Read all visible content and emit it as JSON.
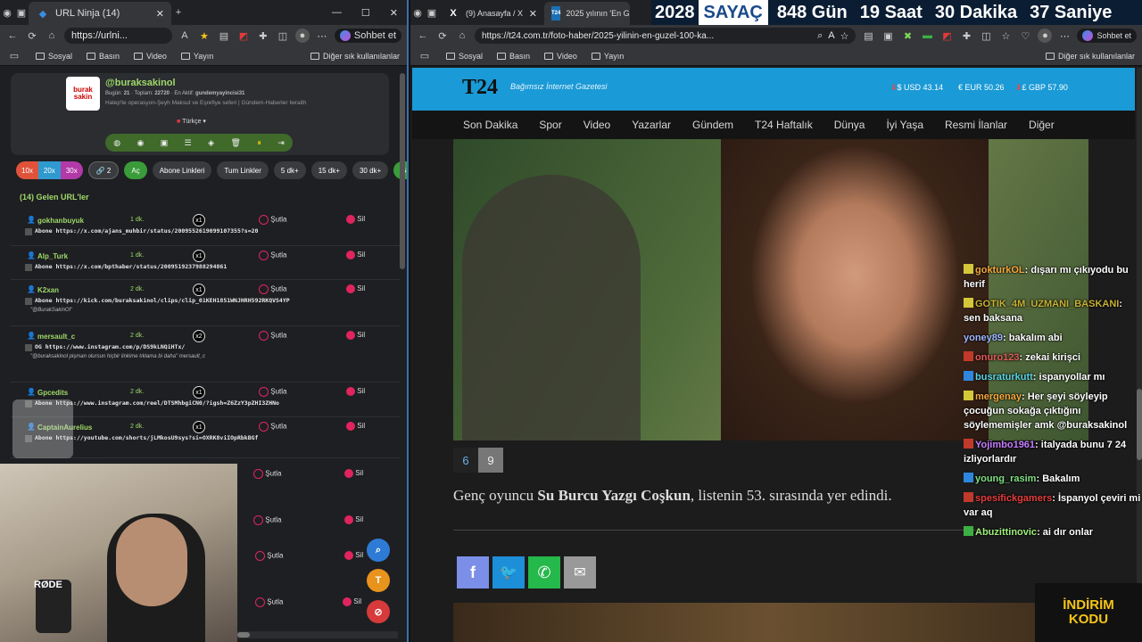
{
  "overlay": {
    "year": "2028",
    "label": "SAYAÇ",
    "days": "848 Gün",
    "hours": "19 Saat",
    "minutes": "30 Dakika",
    "seconds": "37 Saniye",
    "promo_line1": "İNDİRİM",
    "promo_line2": "KODU",
    "mic_brand": "RØDE"
  },
  "left": {
    "tab_title": "URL Ninja (14)",
    "url": "https://urlni...",
    "chat_btn": "Sohbet et",
    "bookmarks": [
      "Sosyal",
      "Basın",
      "Video",
      "Yayın"
    ],
    "other_bookmarks": "Diğer sık kullanılanlar",
    "profile": {
      "handle": "@buraksakinol",
      "today_label": "Bugün:",
      "today": "21",
      "total_label": "Toplam:",
      "total": "22720",
      "active_label": "En Aktif:",
      "active": "gundemyayincisi31",
      "desc": "Halep'te operasyon-Şeyh Maksut ve Eşrefiye seferi | Gündem-Haberler Iwraith",
      "lang": "Türkçe"
    },
    "pills": [
      "10x",
      "20x",
      "30x",
      "2",
      "Aç",
      "Abone Linkleri",
      "Tum Linkler",
      "5 dk+",
      "15 dk+",
      "30 dk+",
      "Güven"
    ],
    "heading": "(14) Gelen URL'ler",
    "action_label": "Şutla",
    "delete_label": "Sil",
    "rows": [
      {
        "user": "gokhanbuyuk",
        "time": "1 dk.",
        "count": "x1",
        "link": "Abone https://x.com/ajans_muhbir/status/2009552619099107355?s=20",
        "note": ""
      },
      {
        "user": "Alp_Turk",
        "time": "1 dk.",
        "count": "x1",
        "link": "Abone https://x.com/bpthaber/status/2009519237988294861",
        "note": ""
      },
      {
        "user": "K2xan",
        "time": "2 dk.",
        "count": "x1",
        "link": "Abone https://kick.com/buraksakinol/clips/clip_01KEH1851WNJHRH592RKQVS4YP",
        "note": "\"@BurakSakinOl\""
      },
      {
        "user": "mersault_c",
        "time": "2 dk.",
        "count": "x2",
        "link": "OG https://www.instagram.com/p/DS9kLNQiHTx/",
        "note": "\"@buraksakinol pişman olursun hiçbir linkime tıklama bi daha\" mersault_c"
      },
      {
        "user": "Gpcedits",
        "time": "2 dk.",
        "count": "x1",
        "link": "Abone https://www.instagram.com/reel/DTSMhbgiCN0/?igsh=Z6ZzY3pZHI3ZHNo",
        "note": ""
      },
      {
        "user": "CaptainAurelius",
        "time": "2 dk.",
        "count": "x1",
        "link": "Abone https://youtube.com/shorts/jLMkosU9sys?si=OXRK8viIOpRbkBGf",
        "note": ""
      }
    ],
    "lower_actions": [
      "Şutla",
      "Şutla",
      "Şutla",
      "Şutla"
    ],
    "lower_deletes": [
      "Sil",
      "Sil",
      "Sil",
      "Sil"
    ],
    "fab_t": "T"
  },
  "right": {
    "tabs": [
      "(9) Anasayfa / X",
      "2025 yılının 'En Güze"
    ],
    "url": "https://t24.com.tr/foto-haber/2025-yilinin-en-guzel-100-ka...",
    "chat_btn": "Sohbet et",
    "bookmarks": [
      "Sosyal",
      "Basın",
      "Video",
      "Yayın"
    ],
    "other_bookmarks": "Diğer sık kullanılanlar",
    "site": {
      "logo": "T24",
      "tagline": "Bağımsız İnternet Gazetesi",
      "usd": "$ USD 43.14",
      "eur": "€ EUR 50.26",
      "gbp": "£ GBP 57.90"
    },
    "nav": [
      "Son Dakika",
      "Spor",
      "Video",
      "Yazarlar",
      "Gündem",
      "T24 Haftalık",
      "Dünya",
      "İyi Yaşa",
      "Resmi İlanlar",
      "Diğer"
    ],
    "pager": [
      "6",
      "9"
    ],
    "caption_pre": "Genç oyuncu ",
    "caption_bold": "Su Burcu Yazgı Coşkun",
    "caption_post": ", listenin 53. sırasında yer edindi."
  },
  "chat": [
    {
      "user": "gokturkOL",
      "text": "dışarı mı çıkıyodu bu herif",
      "color": "#f4a93c",
      "badge": "#d4c83a"
    },
    {
      "user": "GOTIK_4M_UZMANI_BASKANI",
      "text": "sen baksana",
      "color": "#c8b234",
      "badge": "#d4c83a"
    },
    {
      "user": "yoney89",
      "text": "bakalım abi",
      "color": "#9fb7ff",
      "badge": ""
    },
    {
      "user": "onuro123",
      "text": "zekai kirişci",
      "color": "#e85c5c",
      "badge": "#c0392b"
    },
    {
      "user": "busraturkutt",
      "text": "ispanyollar mı",
      "color": "#5ad4e6",
      "badge": "#2e86de"
    },
    {
      "user": "mergenay",
      "text": "Her şeyi söyleyip çocuğun sokağa çıktığını söylememişler amk @buraksakinol",
      "color": "#f4a93c",
      "badge": "#d4c83a"
    },
    {
      "user": "Yojimbo1961",
      "text": "italyada bunu 7 24 izliyorlardır",
      "color": "#c77dff",
      "badge": "#c0392b"
    },
    {
      "user": "young_rasim",
      "text": "Bakalım",
      "color": "#7ee081",
      "badge": "#2e86de"
    },
    {
      "user": "spesifickgamers",
      "text": "İspanyol çeviri mi var aq",
      "color": "#e83c3c",
      "badge": "#c0392b"
    },
    {
      "user": "Abuzittinovic",
      "text": "ai dır onlar",
      "color": "#9ff07a",
      "badge": "#3cb043"
    }
  ]
}
